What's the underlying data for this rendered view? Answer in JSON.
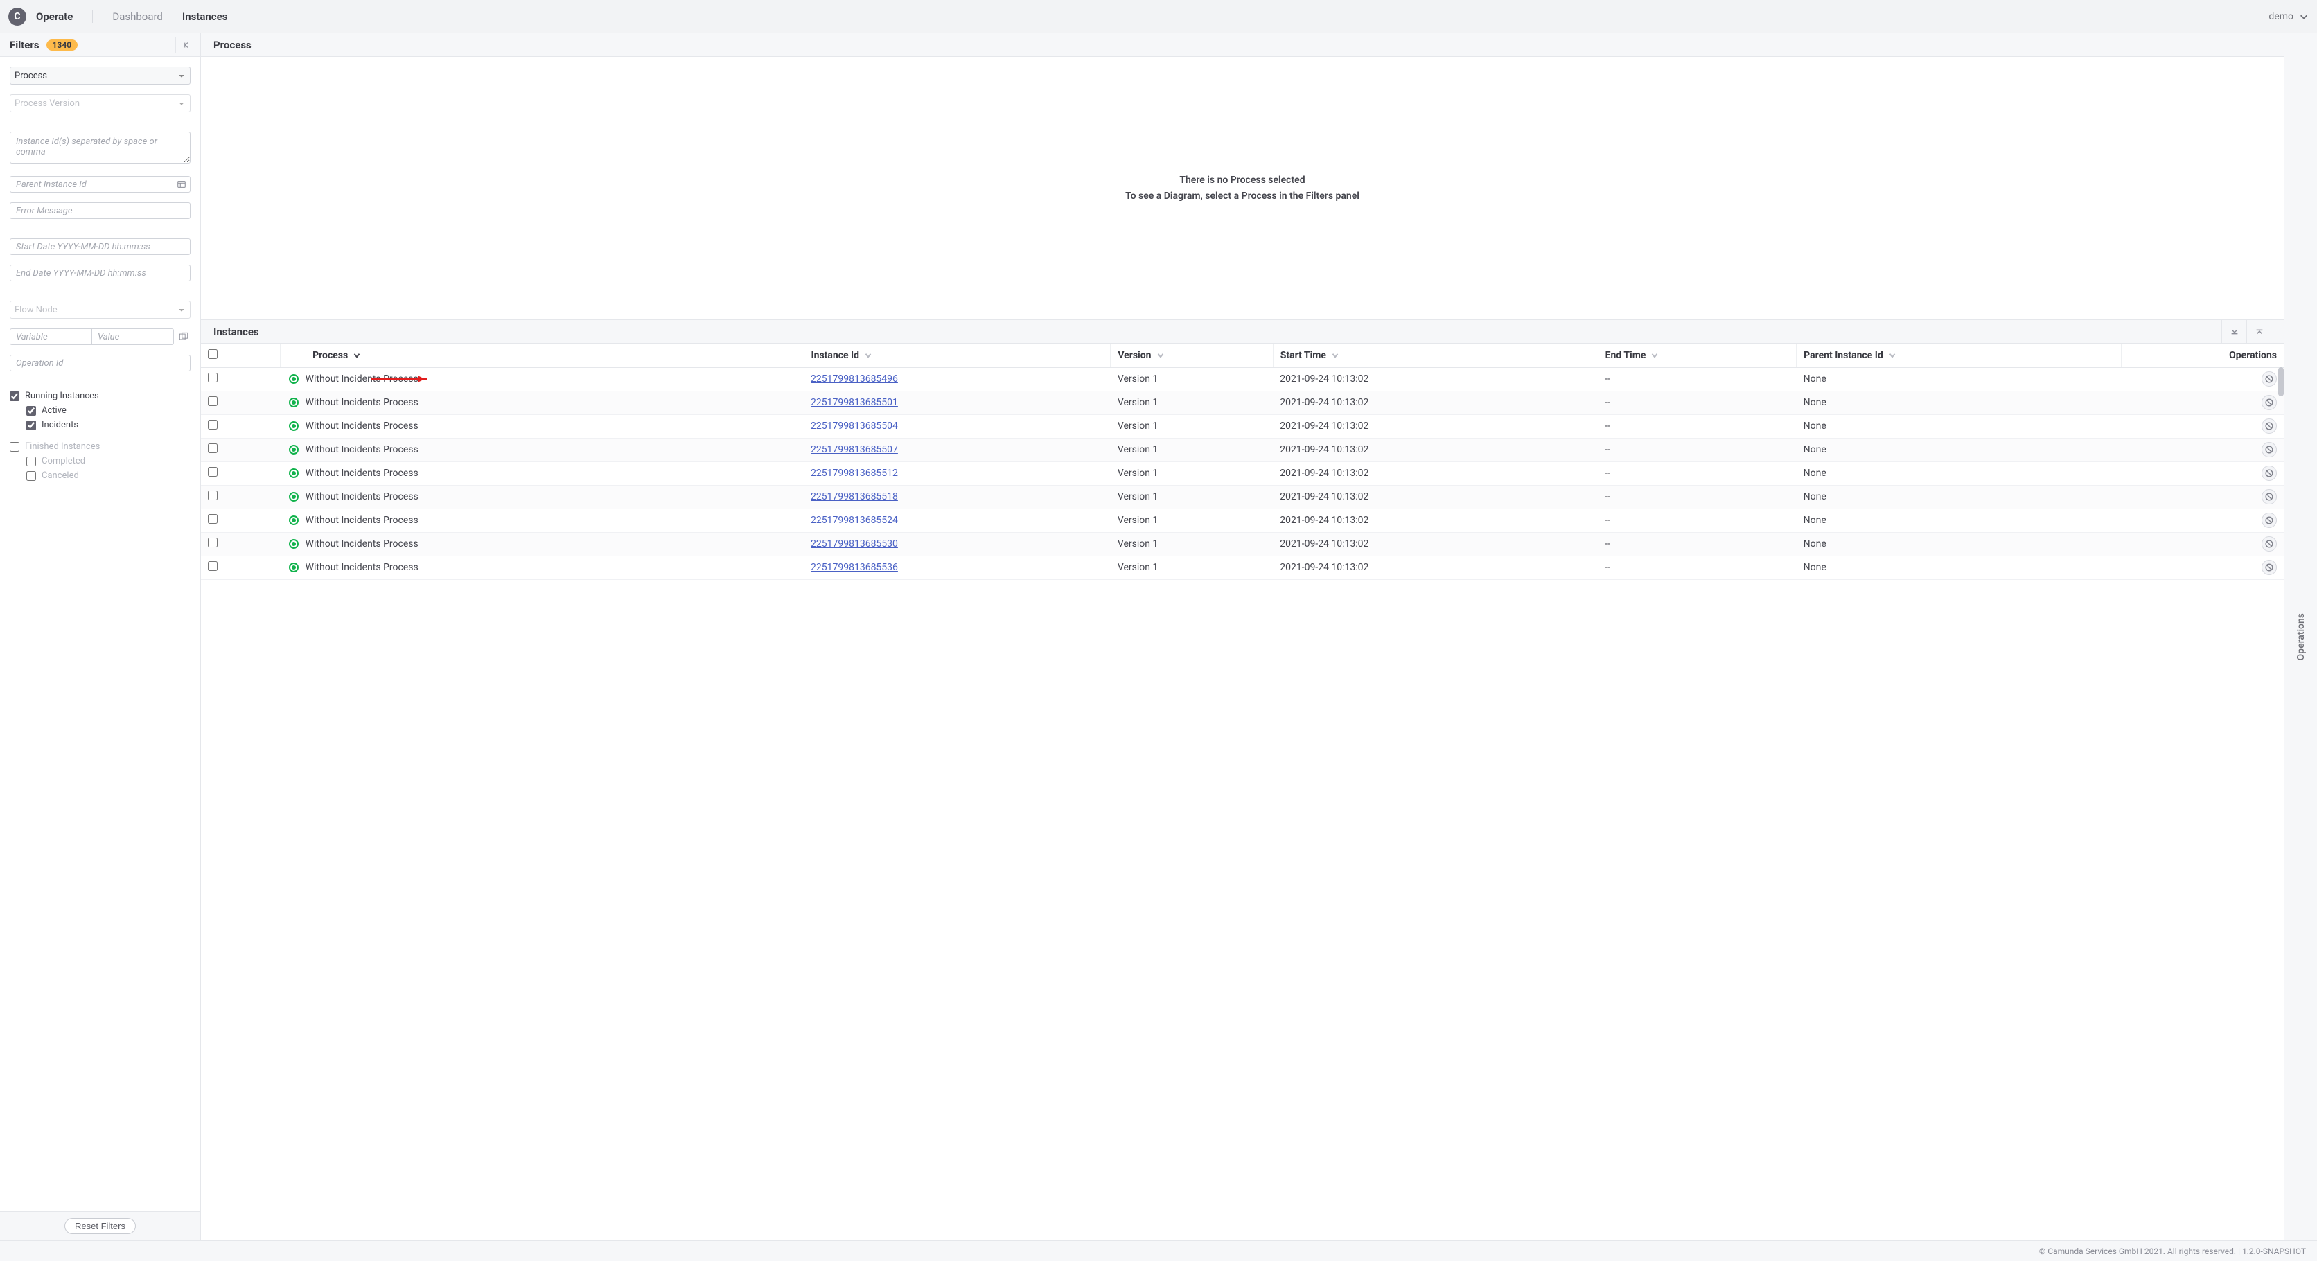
{
  "header": {
    "brand_letter": "C",
    "brand": "Operate",
    "nav": {
      "dashboard": "Dashboard",
      "instances": "Instances"
    },
    "user": "demo"
  },
  "filters": {
    "title": "Filters",
    "count": "1340",
    "process_select_placeholder": "Process",
    "version_select_placeholder": "Process Version",
    "instance_ids_placeholder": "Instance Id(s) separated by space or comma",
    "parent_instance_placeholder": "Parent Instance Id",
    "error_message_placeholder": "Error Message",
    "start_date_placeholder": "Start Date YYYY-MM-DD hh:mm:ss",
    "end_date_placeholder": "End Date YYYY-MM-DD hh:mm:ss",
    "flow_node_placeholder": "Flow Node",
    "variable_placeholder": "Variable",
    "value_placeholder": "Value",
    "operation_id_placeholder": "Operation Id",
    "running_label": "Running Instances",
    "active_label": "Active",
    "incidents_label": "Incidents",
    "finished_label": "Finished Instances",
    "completed_label": "Completed",
    "canceled_label": "Canceled",
    "reset_label": "Reset Filters"
  },
  "process_panel": {
    "header": "Process",
    "empty_line1": "There is no Process selected",
    "empty_line2": "To see a Diagram, select a Process in the Filters panel"
  },
  "instances_panel": {
    "header": "Instances",
    "columns": {
      "process": "Process",
      "instance_id": "Instance Id",
      "version": "Version",
      "start_time": "Start Time",
      "end_time": "End Time",
      "parent_instance_id": "Parent Instance Id",
      "operations": "Operations"
    },
    "rows": [
      {
        "process": "Without Incidents Process",
        "id": "2251799813685496",
        "version": "Version 1",
        "start": "2021-09-24 10:13:02",
        "end": "--",
        "parent": "None"
      },
      {
        "process": "Without Incidents Process",
        "id": "2251799813685501",
        "version": "Version 1",
        "start": "2021-09-24 10:13:02",
        "end": "--",
        "parent": "None"
      },
      {
        "process": "Without Incidents Process",
        "id": "2251799813685504",
        "version": "Version 1",
        "start": "2021-09-24 10:13:02",
        "end": "--",
        "parent": "None"
      },
      {
        "process": "Without Incidents Process",
        "id": "2251799813685507",
        "version": "Version 1",
        "start": "2021-09-24 10:13:02",
        "end": "--",
        "parent": "None"
      },
      {
        "process": "Without Incidents Process",
        "id": "2251799813685512",
        "version": "Version 1",
        "start": "2021-09-24 10:13:02",
        "end": "--",
        "parent": "None"
      },
      {
        "process": "Without Incidents Process",
        "id": "2251799813685518",
        "version": "Version 1",
        "start": "2021-09-24 10:13:02",
        "end": "--",
        "parent": "None"
      },
      {
        "process": "Without Incidents Process",
        "id": "2251799813685524",
        "version": "Version 1",
        "start": "2021-09-24 10:13:02",
        "end": "--",
        "parent": "None"
      },
      {
        "process": "Without Incidents Process",
        "id": "2251799813685530",
        "version": "Version 1",
        "start": "2021-09-24 10:13:02",
        "end": "--",
        "parent": "None"
      },
      {
        "process": "Without Incidents Process",
        "id": "2251799813685536",
        "version": "Version 1",
        "start": "2021-09-24 10:13:02",
        "end": "--",
        "parent": "None"
      }
    ]
  },
  "rightrail": {
    "label": "Operations"
  },
  "footer": {
    "text": "© Camunda Services GmbH 2021. All rights reserved. | 1.2.0-SNAPSHOT"
  }
}
